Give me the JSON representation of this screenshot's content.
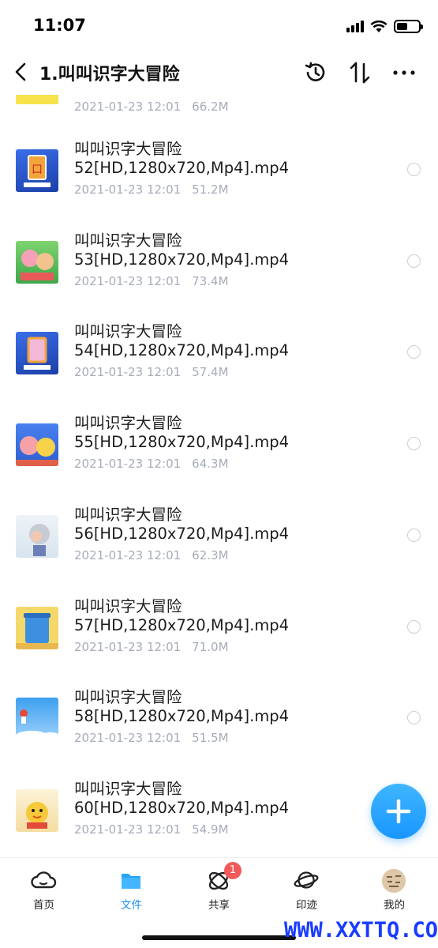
{
  "status_bar": {
    "time": "11:07"
  },
  "header": {
    "title": "1.叫叫识字大冒险"
  },
  "partial_file": {
    "date": "2021-01-23 12:01",
    "size": "66.2M"
  },
  "files": [
    {
      "name": "叫叫识字大冒险 52[HD,1280x720,Mp4].mp4",
      "date": "2021-01-23 12:01",
      "size": "51.2M"
    },
    {
      "name": "叫叫识字大冒险 53[HD,1280x720,Mp4].mp4",
      "date": "2021-01-23 12:01",
      "size": "73.4M"
    },
    {
      "name": "叫叫识字大冒险 54[HD,1280x720,Mp4].mp4",
      "date": "2021-01-23 12:01",
      "size": "57.4M"
    },
    {
      "name": "叫叫识字大冒险 55[HD,1280x720,Mp4].mp4",
      "date": "2021-01-23 12:01",
      "size": "64.3M"
    },
    {
      "name": "叫叫识字大冒险 56[HD,1280x720,Mp4].mp4",
      "date": "2021-01-23 12:01",
      "size": "62.3M"
    },
    {
      "name": "叫叫识字大冒险 57[HD,1280x720,Mp4].mp4",
      "date": "2021-01-23 12:01",
      "size": "71.0M"
    },
    {
      "name": "叫叫识字大冒险 58[HD,1280x720,Mp4].mp4",
      "date": "2021-01-23 12:01",
      "size": "51.5M"
    },
    {
      "name": "叫叫识字大冒险 60[HD,1280x720,Mp4].mp4",
      "date": "2021-01-23 12:01",
      "size": "54.9M"
    }
  ],
  "tabs": [
    {
      "label": "首页",
      "icon": "cloud-icon",
      "active": false
    },
    {
      "label": "文件",
      "icon": "folder-icon",
      "active": true
    },
    {
      "label": "共享",
      "icon": "share-orbit-icon",
      "active": false,
      "badge": "1"
    },
    {
      "label": "印迹",
      "icon": "planet-icon",
      "active": false
    },
    {
      "label": "我的",
      "icon": "avatar",
      "active": false
    }
  ],
  "colors": {
    "accent": "#1f8ff0",
    "badge": "#f25a5a",
    "meta_text": "#a6acb8"
  },
  "watermark": "WWW.XXTTQ.COM"
}
